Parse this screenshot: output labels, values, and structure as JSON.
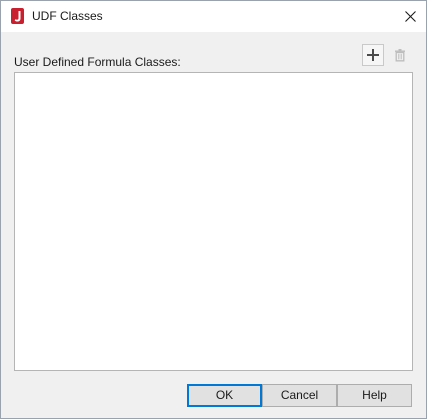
{
  "window": {
    "title": "UDF Classes",
    "app_icon": "jreport-icon",
    "close_icon": "close-icon"
  },
  "content": {
    "label": "User Defined Formula Classes:",
    "items": []
  },
  "toolbar": {
    "add_icon": "plus-icon",
    "delete_icon": "trash-icon",
    "delete_enabled": false
  },
  "buttons": {
    "ok_label": "OK",
    "cancel_label": "Cancel",
    "help_label": "Help"
  },
  "colors": {
    "brand": "#c8202f",
    "default_button_border": "#0078d7"
  }
}
